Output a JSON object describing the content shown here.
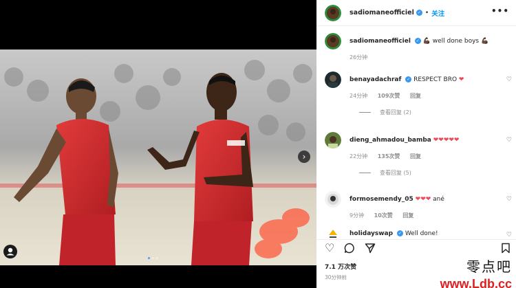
{
  "post": {
    "author": "sadiomaneofficiel",
    "follow_label": "关注",
    "separator": "•",
    "more_icon": "•••"
  },
  "caption": {
    "author": "sadiomaneofficiel",
    "text_emoji_left": "💪🏿",
    "text": "well done boys",
    "text_emoji_right": "💪🏿",
    "time": "26分钟"
  },
  "comments": [
    {
      "user": "benayadachraf",
      "text": "RESPECT BRO",
      "emoji": "❤",
      "time": "24分钟",
      "likes": "109次赞",
      "reply": "回复",
      "view_replies": "查看回复 (2)"
    },
    {
      "user": "dieng_ahmadou_bamba",
      "text": "",
      "emoji": "❤❤❤❤❤",
      "time": "22分钟",
      "likes": "135次赞",
      "reply": "回复",
      "view_replies": "查看回复 (5)"
    },
    {
      "user": "formosemendy_05",
      "text": "",
      "emoji": "❤❤❤",
      "suffix": "ané",
      "time": "9分钟",
      "likes": "10次赞",
      "reply": "回复"
    },
    {
      "user": "holidayswap",
      "text": "Well done!"
    }
  ],
  "footer": {
    "likes_count": "7.1 万次赞",
    "posted": "30分钟前"
  },
  "watermark": {
    "line1": "零点吧",
    "line2": "www.Ldb.cc"
  },
  "colors": {
    "accent": "#0095f6",
    "verified": "#3897f0",
    "heart_red": "#ed4956",
    "jersey_red": "#d62b2b"
  }
}
